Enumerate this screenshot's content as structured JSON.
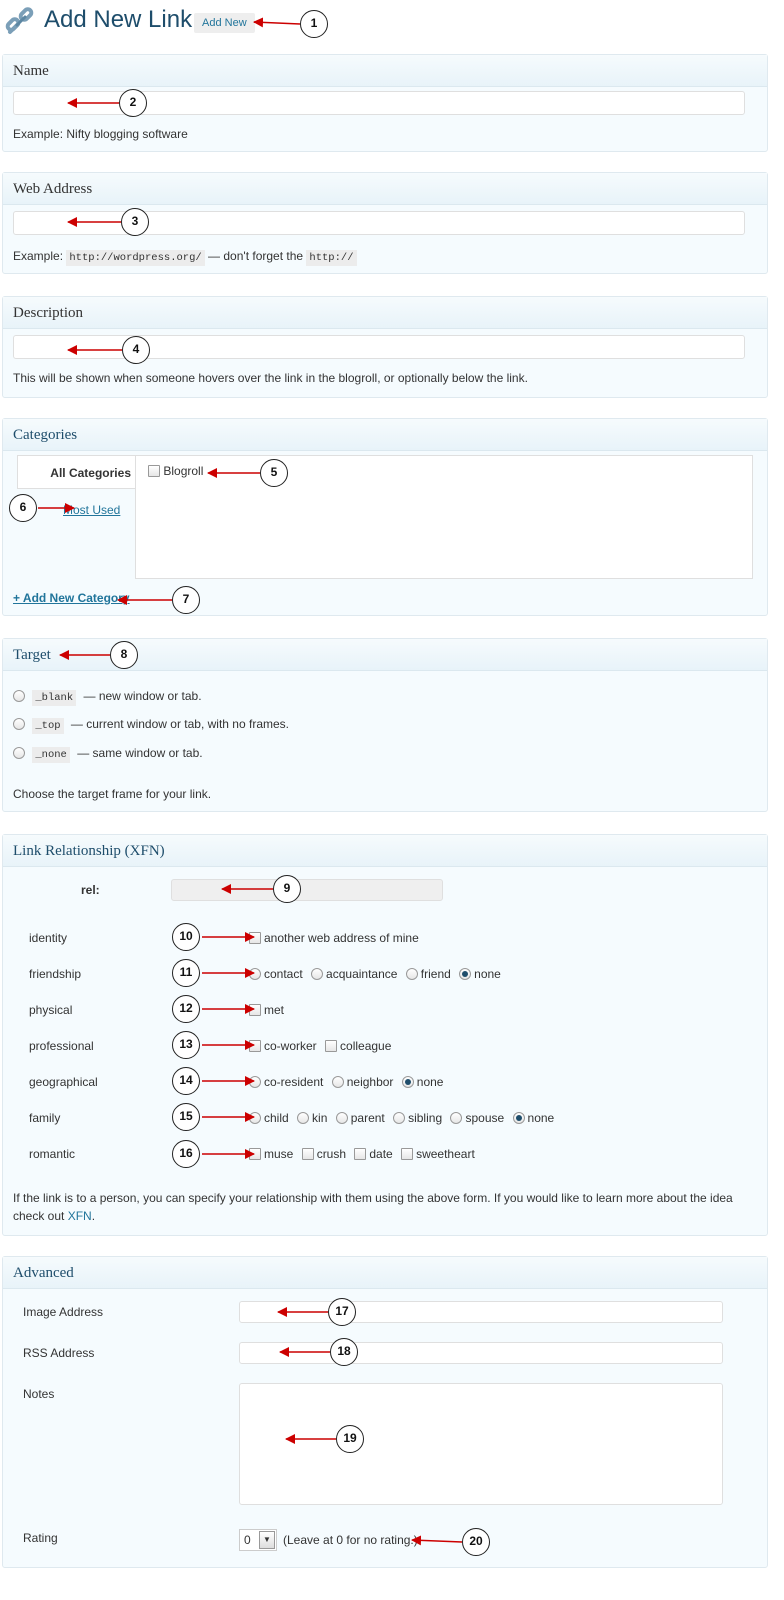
{
  "header": {
    "title": "Add New Link",
    "add_new_label": "Add New"
  },
  "name_box": {
    "title": "Name",
    "value": "",
    "help": "Example: Nifty blogging software"
  },
  "web_address_box": {
    "title": "Web Address",
    "value": "",
    "help_prefix": "Example:",
    "help_code1": "http://wordpress.org/",
    "help_mid": "— don't forget the",
    "help_code2": "http://"
  },
  "description_box": {
    "title": "Description",
    "value": "",
    "help": "This will be shown when someone hovers over the link in the blogroll, or optionally below the link."
  },
  "categories_box": {
    "title": "Categories",
    "tab_all": "All Categories",
    "tab_most_used": "Most Used",
    "items": [
      {
        "label": "Blogroll",
        "checked": false
      }
    ],
    "add_new_label": "+ Add New Category"
  },
  "target_box": {
    "title": "Target",
    "options": [
      {
        "code": "_blank",
        "label": "— new window or tab.",
        "checked": false
      },
      {
        "code": "_top",
        "label": "— current window or tab, with no frames.",
        "checked": false
      },
      {
        "code": "_none",
        "label": "— same window or tab.",
        "checked": false
      }
    ],
    "help": "Choose the target frame for your link."
  },
  "xfn_box": {
    "title": "Link Relationship (XFN)",
    "rel_label": "rel:",
    "rel_value": "",
    "rows": [
      {
        "label": "identity",
        "type": "checkbox",
        "options": [
          {
            "label": "another web address of mine",
            "checked": false
          }
        ]
      },
      {
        "label": "friendship",
        "type": "radio",
        "options": [
          {
            "label": "contact",
            "checked": false
          },
          {
            "label": "acquaintance",
            "checked": false
          },
          {
            "label": "friend",
            "checked": false
          },
          {
            "label": "none",
            "checked": true
          }
        ]
      },
      {
        "label": "physical",
        "type": "checkbox",
        "options": [
          {
            "label": "met",
            "checked": false
          }
        ]
      },
      {
        "label": "professional",
        "type": "checkbox",
        "options": [
          {
            "label": "co-worker",
            "checked": false
          },
          {
            "label": "colleague",
            "checked": false
          }
        ]
      },
      {
        "label": "geographical",
        "type": "radio",
        "options": [
          {
            "label": "co-resident",
            "checked": false
          },
          {
            "label": "neighbor",
            "checked": false
          },
          {
            "label": "none",
            "checked": true
          }
        ]
      },
      {
        "label": "family",
        "type": "radio",
        "options": [
          {
            "label": "child",
            "checked": false
          },
          {
            "label": "kin",
            "checked": false
          },
          {
            "label": "parent",
            "checked": false
          },
          {
            "label": "sibling",
            "checked": false
          },
          {
            "label": "spouse",
            "checked": false
          },
          {
            "label": "none",
            "checked": true
          }
        ]
      },
      {
        "label": "romantic",
        "type": "checkbox",
        "options": [
          {
            "label": "muse",
            "checked": false
          },
          {
            "label": "crush",
            "checked": false
          },
          {
            "label": "date",
            "checked": false
          },
          {
            "label": "sweetheart",
            "checked": false
          }
        ]
      }
    ],
    "help_line1": "If the link is to a person, you can specify your relationship with them using the above form. If you would like to learn more about the idea",
    "help_line2_prefix": "check out",
    "help_link": "XFN",
    "help_line2_suffix": "."
  },
  "advanced_box": {
    "title": "Advanced",
    "image_label": "Image Address",
    "image_value": "",
    "rss_label": "RSS Address",
    "rss_value": "",
    "notes_label": "Notes",
    "notes_value": "",
    "rating_label": "Rating",
    "rating_value": "0",
    "rating_help": "(Leave at 0 for no rating.)"
  },
  "callouts": [
    "1",
    "2",
    "3",
    "4",
    "5",
    "6",
    "7",
    "8",
    "9",
    "10",
    "11",
    "12",
    "13",
    "14",
    "15",
    "16",
    "17",
    "18",
    "19",
    "20"
  ],
  "colors": {
    "accent": "#21759b",
    "title": "#1e4d6b",
    "arrow": "#cc0000",
    "box_bg": "#f5fbfe"
  }
}
